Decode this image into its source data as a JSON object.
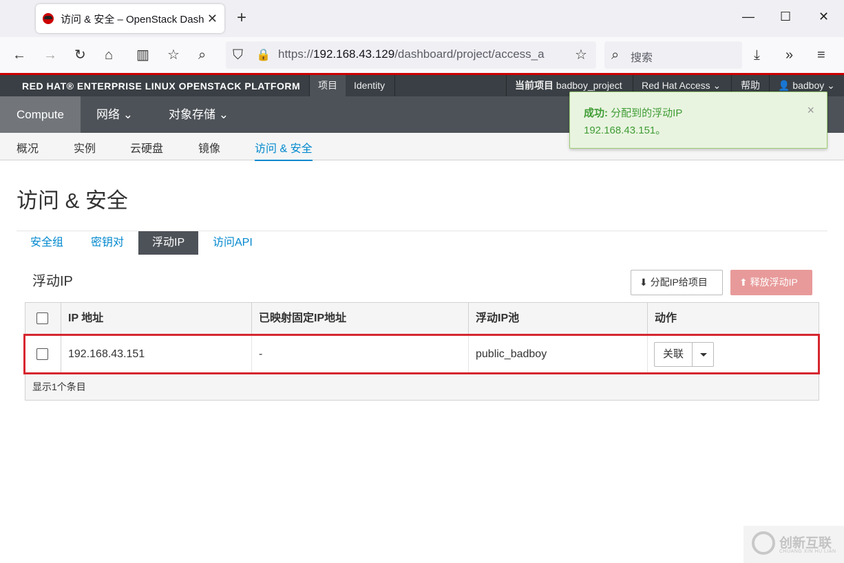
{
  "browser": {
    "tab_title": "访问 & 安全 – OpenStack Dash",
    "url_prefix": "https://",
    "url_host": "192.168.43.129",
    "url_path": "/dashboard/project/access_a",
    "search_placeholder": "搜索"
  },
  "header": {
    "brand": "RED HAT® ENTERPRISE LINUX OPENSTACK PLATFORM",
    "tabs": [
      "项目",
      "Identity"
    ],
    "current_project_label": "当前项目",
    "current_project": "badboy_project",
    "red_hat_access": "Red Hat Access",
    "help": "帮助",
    "user": "badboy"
  },
  "nav": {
    "items": [
      "Compute",
      "网络",
      "对象存储"
    ]
  },
  "subnav": {
    "items": [
      "概况",
      "实例",
      "云硬盘",
      "镜像",
      "访问 & 安全"
    ]
  },
  "alert": {
    "title": "成功:",
    "message": "分配到的浮动IP",
    "message2": "192.168.43.151。"
  },
  "page": {
    "title": "访问 & 安全",
    "tabs": [
      "安全组",
      "密钥对",
      "浮动IP",
      "访问API"
    ],
    "section_title": "浮动IP",
    "allocate_button": "分配IP给项目",
    "release_button": "释放浮动IP"
  },
  "table": {
    "columns": [
      "IP 地址",
      "已映射固定IP地址",
      "浮动IP池",
      "动作"
    ],
    "rows": [
      {
        "ip": "192.168.43.151",
        "fixed_ip": "-",
        "pool": "public_badboy",
        "action": "关联"
      }
    ],
    "footer": "显示1个条目"
  },
  "watermark": {
    "text": "创新互联",
    "sub": "CHUANG XIN HU LIAN"
  }
}
